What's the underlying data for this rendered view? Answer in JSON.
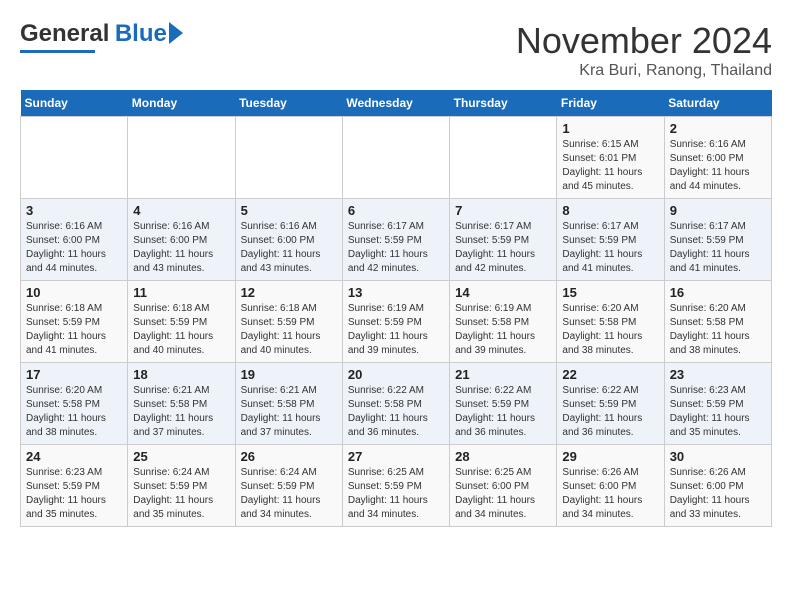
{
  "header": {
    "logo_line1": "General",
    "logo_line2": "Blue",
    "month": "November 2024",
    "location": "Kra Buri, Ranong, Thailand"
  },
  "days_of_week": [
    "Sunday",
    "Monday",
    "Tuesday",
    "Wednesday",
    "Thursday",
    "Friday",
    "Saturday"
  ],
  "weeks": [
    [
      {
        "day": "",
        "info": ""
      },
      {
        "day": "",
        "info": ""
      },
      {
        "day": "",
        "info": ""
      },
      {
        "day": "",
        "info": ""
      },
      {
        "day": "",
        "info": ""
      },
      {
        "day": "1",
        "info": "Sunrise: 6:15 AM\nSunset: 6:01 PM\nDaylight: 11 hours\nand 45 minutes."
      },
      {
        "day": "2",
        "info": "Sunrise: 6:16 AM\nSunset: 6:00 PM\nDaylight: 11 hours\nand 44 minutes."
      }
    ],
    [
      {
        "day": "3",
        "info": "Sunrise: 6:16 AM\nSunset: 6:00 PM\nDaylight: 11 hours\nand 44 minutes."
      },
      {
        "day": "4",
        "info": "Sunrise: 6:16 AM\nSunset: 6:00 PM\nDaylight: 11 hours\nand 43 minutes."
      },
      {
        "day": "5",
        "info": "Sunrise: 6:16 AM\nSunset: 6:00 PM\nDaylight: 11 hours\nand 43 minutes."
      },
      {
        "day": "6",
        "info": "Sunrise: 6:17 AM\nSunset: 5:59 PM\nDaylight: 11 hours\nand 42 minutes."
      },
      {
        "day": "7",
        "info": "Sunrise: 6:17 AM\nSunset: 5:59 PM\nDaylight: 11 hours\nand 42 minutes."
      },
      {
        "day": "8",
        "info": "Sunrise: 6:17 AM\nSunset: 5:59 PM\nDaylight: 11 hours\nand 41 minutes."
      },
      {
        "day": "9",
        "info": "Sunrise: 6:17 AM\nSunset: 5:59 PM\nDaylight: 11 hours\nand 41 minutes."
      }
    ],
    [
      {
        "day": "10",
        "info": "Sunrise: 6:18 AM\nSunset: 5:59 PM\nDaylight: 11 hours\nand 41 minutes."
      },
      {
        "day": "11",
        "info": "Sunrise: 6:18 AM\nSunset: 5:59 PM\nDaylight: 11 hours\nand 40 minutes."
      },
      {
        "day": "12",
        "info": "Sunrise: 6:18 AM\nSunset: 5:59 PM\nDaylight: 11 hours\nand 40 minutes."
      },
      {
        "day": "13",
        "info": "Sunrise: 6:19 AM\nSunset: 5:59 PM\nDaylight: 11 hours\nand 39 minutes."
      },
      {
        "day": "14",
        "info": "Sunrise: 6:19 AM\nSunset: 5:58 PM\nDaylight: 11 hours\nand 39 minutes."
      },
      {
        "day": "15",
        "info": "Sunrise: 6:20 AM\nSunset: 5:58 PM\nDaylight: 11 hours\nand 38 minutes."
      },
      {
        "day": "16",
        "info": "Sunrise: 6:20 AM\nSunset: 5:58 PM\nDaylight: 11 hours\nand 38 minutes."
      }
    ],
    [
      {
        "day": "17",
        "info": "Sunrise: 6:20 AM\nSunset: 5:58 PM\nDaylight: 11 hours\nand 38 minutes."
      },
      {
        "day": "18",
        "info": "Sunrise: 6:21 AM\nSunset: 5:58 PM\nDaylight: 11 hours\nand 37 minutes."
      },
      {
        "day": "19",
        "info": "Sunrise: 6:21 AM\nSunset: 5:58 PM\nDaylight: 11 hours\nand 37 minutes."
      },
      {
        "day": "20",
        "info": "Sunrise: 6:22 AM\nSunset: 5:58 PM\nDaylight: 11 hours\nand 36 minutes."
      },
      {
        "day": "21",
        "info": "Sunrise: 6:22 AM\nSunset: 5:59 PM\nDaylight: 11 hours\nand 36 minutes."
      },
      {
        "day": "22",
        "info": "Sunrise: 6:22 AM\nSunset: 5:59 PM\nDaylight: 11 hours\nand 36 minutes."
      },
      {
        "day": "23",
        "info": "Sunrise: 6:23 AM\nSunset: 5:59 PM\nDaylight: 11 hours\nand 35 minutes."
      }
    ],
    [
      {
        "day": "24",
        "info": "Sunrise: 6:23 AM\nSunset: 5:59 PM\nDaylight: 11 hours\nand 35 minutes."
      },
      {
        "day": "25",
        "info": "Sunrise: 6:24 AM\nSunset: 5:59 PM\nDaylight: 11 hours\nand 35 minutes."
      },
      {
        "day": "26",
        "info": "Sunrise: 6:24 AM\nSunset: 5:59 PM\nDaylight: 11 hours\nand 34 minutes."
      },
      {
        "day": "27",
        "info": "Sunrise: 6:25 AM\nSunset: 5:59 PM\nDaylight: 11 hours\nand 34 minutes."
      },
      {
        "day": "28",
        "info": "Sunrise: 6:25 AM\nSunset: 6:00 PM\nDaylight: 11 hours\nand 34 minutes."
      },
      {
        "day": "29",
        "info": "Sunrise: 6:26 AM\nSunset: 6:00 PM\nDaylight: 11 hours\nand 34 minutes."
      },
      {
        "day": "30",
        "info": "Sunrise: 6:26 AM\nSunset: 6:00 PM\nDaylight: 11 hours\nand 33 minutes."
      }
    ]
  ]
}
